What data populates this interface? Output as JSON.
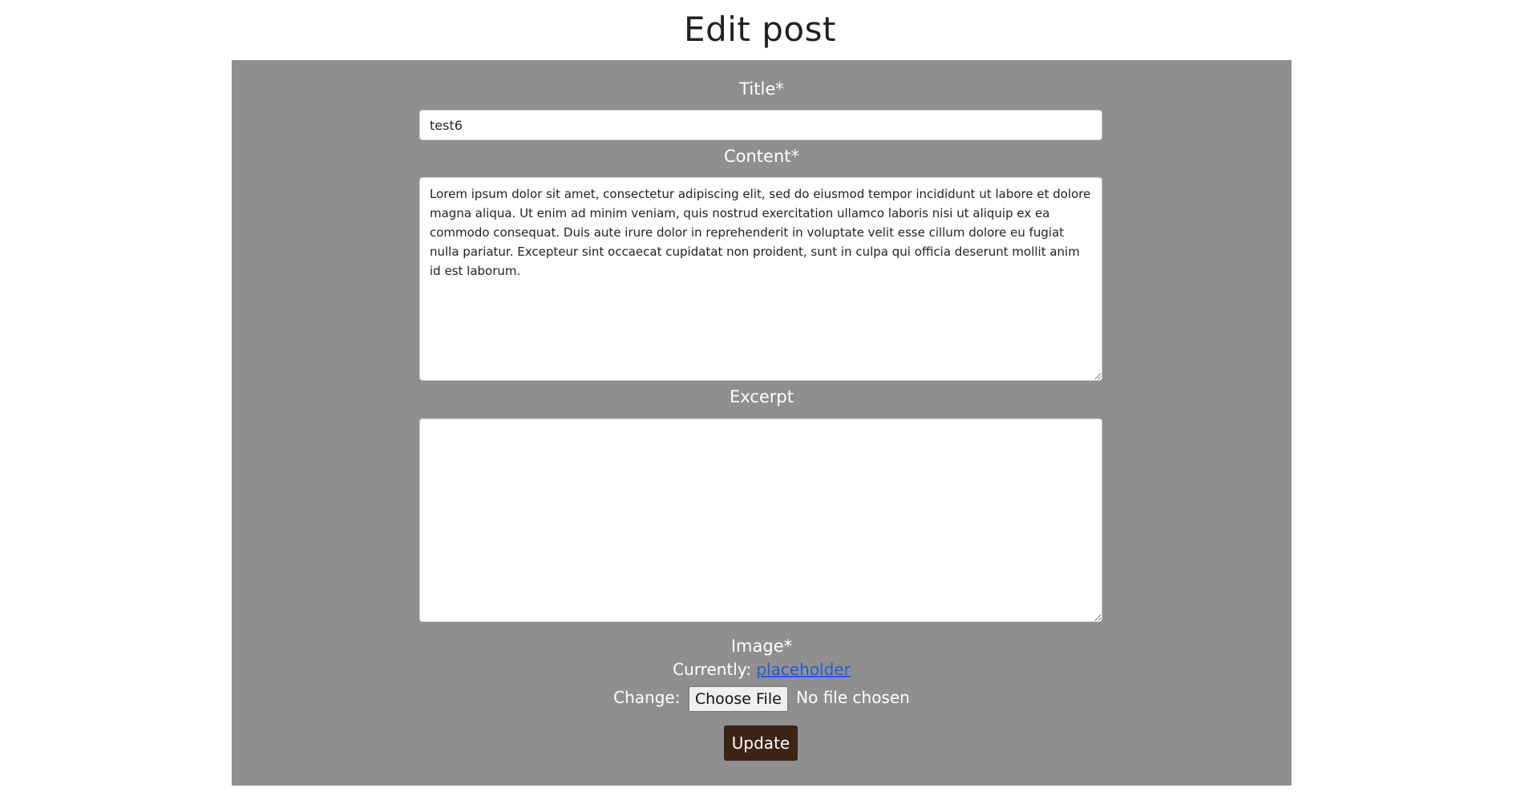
{
  "page": {
    "title": "Edit post"
  },
  "form": {
    "title_label": "Title*",
    "title_value": "test6",
    "content_label": "Content*",
    "content_value": "Lorem ipsum dolor sit amet, consectetur adipiscing elit, sed do eiusmod tempor incididunt ut labore et dolore magna aliqua. Ut enim ad minim veniam, quis nostrud exercitation ullamco laboris nisi ut aliquip ex ea commodo consequat. Duis aute irure dolor in reprehenderit in voluptate velit esse cillum dolore eu fugiat nulla pariatur. Excepteur sint occaecat cupidatat non proident, sunt in culpa qui officia deserunt mollit anim id est laborum.",
    "excerpt_label": "Excerpt",
    "excerpt_value": "",
    "image_label": "Image*",
    "currently_label": "Currently:",
    "currently_link": "placeholder",
    "change_label": "Change:",
    "choose_file_label": "Choose File",
    "no_file_text": "No file chosen",
    "update_label": "Update"
  },
  "colors": {
    "panel_background": "#8f8f8f",
    "update_button": "#3b2316",
    "link": "#1a5fe0"
  }
}
